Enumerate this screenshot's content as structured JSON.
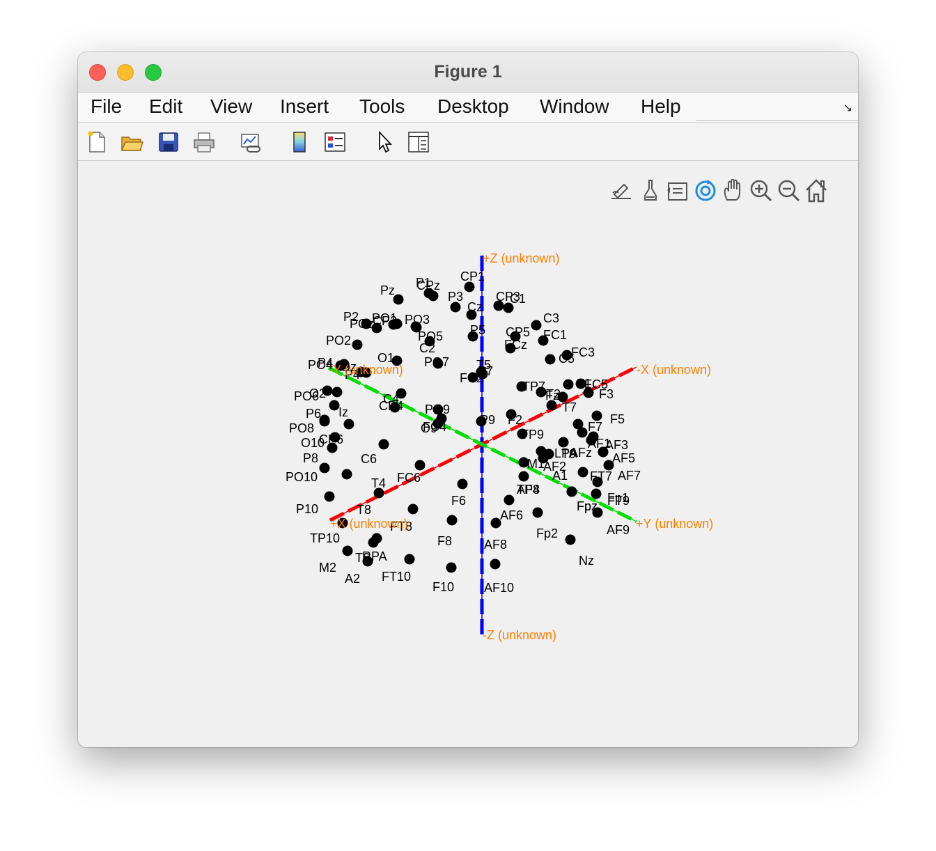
{
  "window": {
    "title": "Figure 1"
  },
  "menu": [
    "File",
    "Edit",
    "View",
    "Insert",
    "Tools",
    "Desktop",
    "Window",
    "Help"
  ],
  "toolbar": {
    "icons": [
      "new-figure-icon",
      "open-file-icon",
      "save-icon",
      "print-icon",
      "link-plot-icon",
      "colorbar-icon",
      "legend-icon",
      "pointer-icon",
      "property-inspector-icon"
    ]
  },
  "axes_toolbar": {
    "icons": [
      "brush-edit-icon",
      "data-brush-icon",
      "data-tips-icon",
      "rotate-3d-icon",
      "pan-hand-icon",
      "zoom-in-icon",
      "zoom-out-icon",
      "home-icon"
    ],
    "active": "rotate-3d-icon"
  },
  "colors": {
    "x_axis": "#ff0000",
    "y_axis": "#00dd00",
    "z_axis": "#0000ff",
    "axis_label": "#ff7f00",
    "marker": "#000000"
  },
  "chart_data": {
    "type": "scatter",
    "axis_labels": [
      "+X (unknown)",
      "-X (unknown)",
      "+Y (unknown)",
      "-Y (unknown)",
      "+Z (unknown)",
      "-Z (unknown)"
    ],
    "electrodes": [
      {
        "label": "Pz"
      },
      {
        "label": "P1"
      },
      {
        "label": "CPz"
      },
      {
        "label": "CP1"
      },
      {
        "label": "P3"
      },
      {
        "label": "CP3"
      },
      {
        "label": "C1"
      },
      {
        "label": "Cz"
      },
      {
        "label": "P2"
      },
      {
        "label": "PO1"
      },
      {
        "label": "POz"
      },
      {
        "label": "CP2"
      },
      {
        "label": "PO3"
      },
      {
        "label": "C3"
      },
      {
        "label": "P5"
      },
      {
        "label": "PO2"
      },
      {
        "label": "CP5"
      },
      {
        "label": "FC1"
      },
      {
        "label": "PO5"
      },
      {
        "label": "FCz"
      },
      {
        "label": "O1"
      },
      {
        "label": "C2"
      },
      {
        "label": "PO7"
      },
      {
        "label": "FC3"
      },
      {
        "label": "PO4"
      },
      {
        "label": "P4"
      },
      {
        "label": "Oz"
      },
      {
        "label": "C5"
      },
      {
        "label": "T5"
      },
      {
        "label": "P7"
      },
      {
        "label": "FC2"
      },
      {
        "label": "P4"
      },
      {
        "label": "F1"
      },
      {
        "label": "FC5"
      },
      {
        "label": "TP7"
      },
      {
        "label": "F3"
      },
      {
        "label": "Fz"
      },
      {
        "label": "T3"
      },
      {
        "label": "PO6"
      },
      {
        "label": "O2"
      },
      {
        "label": "C4"
      },
      {
        "label": "T7"
      },
      {
        "label": "Iz"
      },
      {
        "label": "PO9"
      },
      {
        "label": "CP4"
      },
      {
        "label": "P6"
      },
      {
        "label": "F5"
      },
      {
        "label": "F2"
      },
      {
        "label": "FC4"
      },
      {
        "label": "O9"
      },
      {
        "label": "PO8"
      },
      {
        "label": "F7"
      },
      {
        "label": "P9"
      },
      {
        "label": "CP6"
      },
      {
        "label": "TP9"
      },
      {
        "label": "AF1"
      },
      {
        "label": "AF3"
      },
      {
        "label": "O10"
      },
      {
        "label": "LPA"
      },
      {
        "label": "AFz"
      },
      {
        "label": "T9"
      },
      {
        "label": "P8"
      },
      {
        "label": "C6"
      },
      {
        "label": "M1"
      },
      {
        "label": "AF5"
      },
      {
        "label": "AF2"
      },
      {
        "label": "A1"
      },
      {
        "label": "FC6"
      },
      {
        "label": "PO10"
      },
      {
        "label": "FT7"
      },
      {
        "label": "AF7"
      },
      {
        "label": "T4"
      },
      {
        "label": "TP8"
      },
      {
        "label": "AF4"
      },
      {
        "label": "Fp1"
      },
      {
        "label": "F6"
      },
      {
        "label": "FT9"
      },
      {
        "label": "P10"
      },
      {
        "label": "Fpz"
      },
      {
        "label": "T8"
      },
      {
        "label": "AF6"
      },
      {
        "label": "FT8"
      },
      {
        "label": "Fp2"
      },
      {
        "label": "AF9"
      },
      {
        "label": "TP10"
      },
      {
        "label": "F8"
      },
      {
        "label": "AF8"
      },
      {
        "label": "RPA"
      },
      {
        "label": "T6"
      },
      {
        "label": "Nz"
      },
      {
        "label": "M2"
      },
      {
        "label": "A2"
      },
      {
        "label": "FT10"
      },
      {
        "label": "F10"
      },
      {
        "label": "AF10"
      },
      {
        "label": "Fpz"
      }
    ]
  }
}
